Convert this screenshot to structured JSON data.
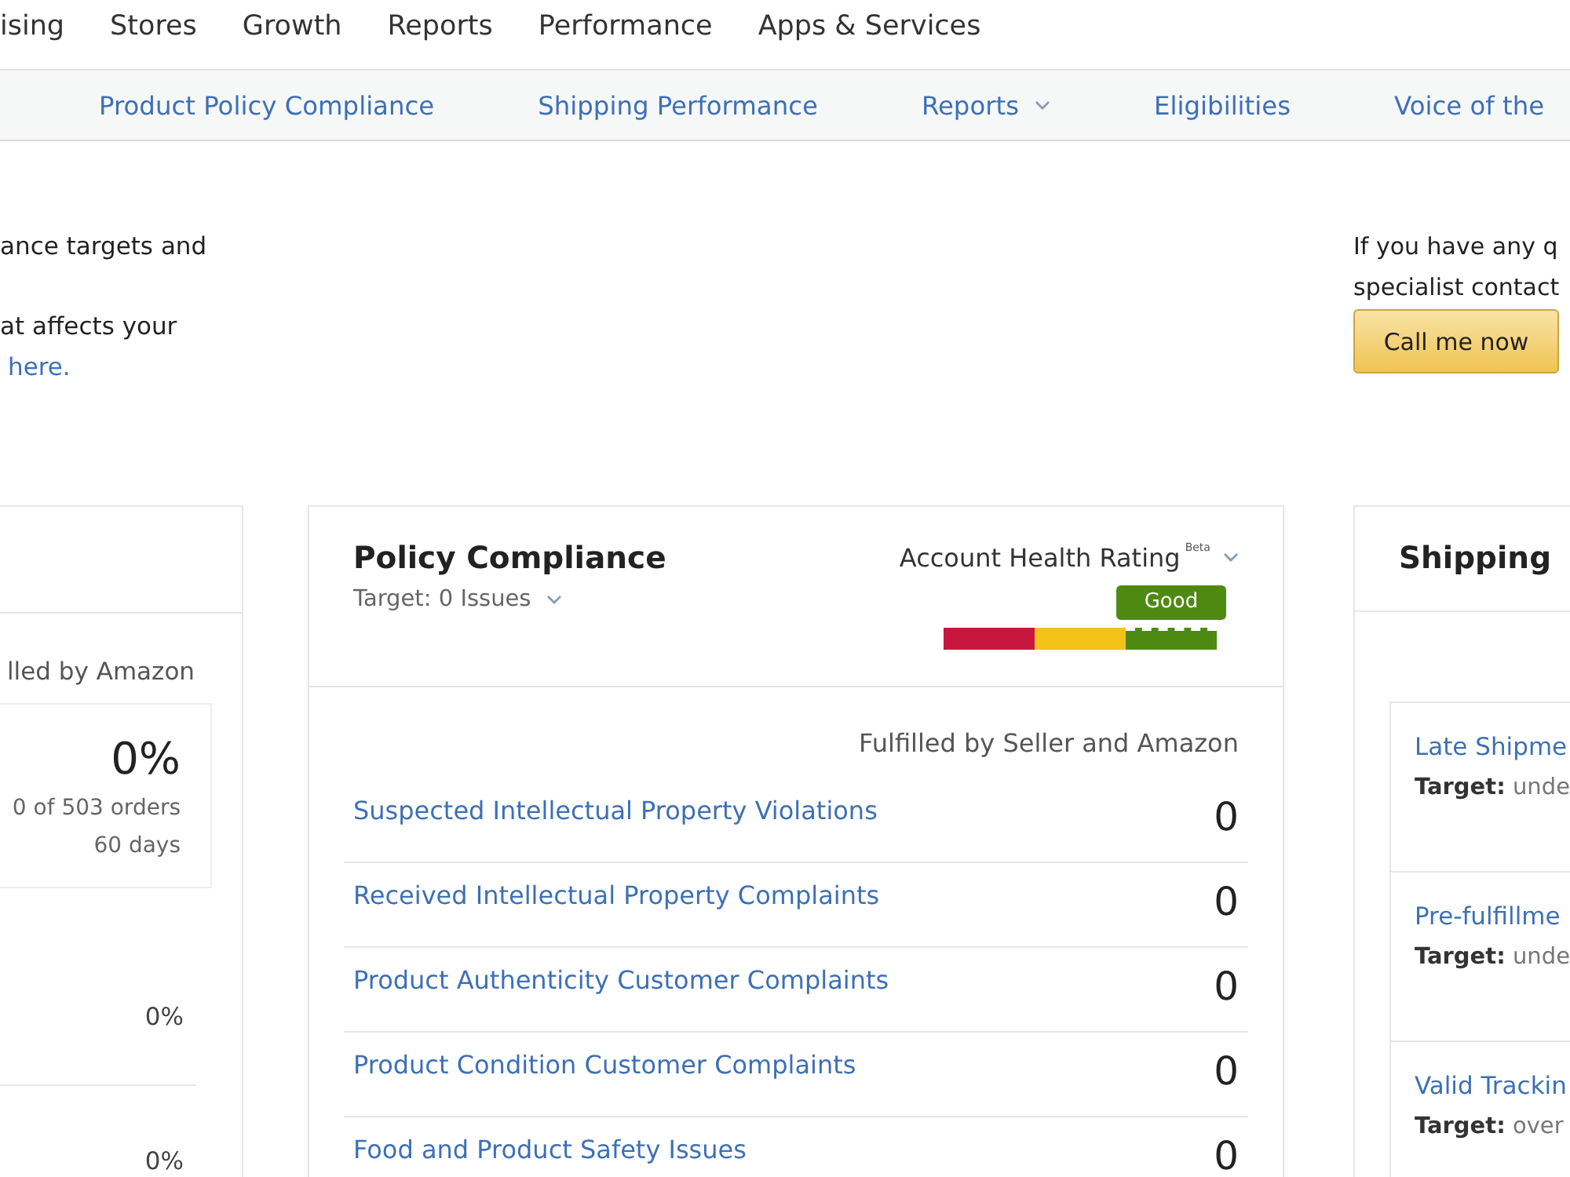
{
  "top_nav": {
    "items": [
      "ising",
      "Stores",
      "Growth",
      "Reports",
      "Performance",
      "Apps & Services"
    ]
  },
  "sub_nav": {
    "items": [
      {
        "label": "Product Policy Compliance",
        "dropdown": false
      },
      {
        "label": "Shipping Performance",
        "dropdown": false
      },
      {
        "label": "Reports",
        "dropdown": true
      },
      {
        "label": "Eligibilities",
        "dropdown": false
      },
      {
        "label": "Voice of the",
        "dropdown": false
      }
    ]
  },
  "intro": {
    "lines": [
      "ance targets and",
      "at affects your"
    ],
    "link": "here."
  },
  "contact": {
    "lines": [
      "If you have any q",
      "specialist contact"
    ],
    "button": "Call me now"
  },
  "left_card": {
    "subtitle": "lled by Amazon",
    "summary": {
      "value": "0%",
      "detail": "0 of 503 orders",
      "period": "60 days"
    },
    "rows": [
      {
        "value": "0%"
      },
      {
        "value": "0%"
      }
    ]
  },
  "policy_card": {
    "title": "Policy Compliance",
    "target": "Target: 0 Issues",
    "rating": {
      "label": "Account Health Rating",
      "tag": "Beta",
      "status": "Good",
      "segments": [
        {
          "color": "#c8173f",
          "selected": false
        },
        {
          "color": "#f2c21b",
          "selected": false
        },
        {
          "color": "#4e8a12",
          "selected": true
        }
      ]
    },
    "column_heading": "Fulfilled by Seller and Amazon",
    "rows": [
      {
        "label": "Suspected Intellectual Property Violations",
        "value": "0"
      },
      {
        "label": "Received Intellectual Property Complaints",
        "value": "0"
      },
      {
        "label": "Product Authenticity Customer Complaints",
        "value": "0"
      },
      {
        "label": "Product Condition Customer Complaints",
        "value": "0"
      },
      {
        "label": "Food and Product Safety Issues",
        "value": "0"
      }
    ]
  },
  "shipping_card": {
    "title": "Shipping",
    "items": [
      {
        "label": "Late Shipme",
        "target": "**Target:** unde"
      },
      {
        "label": "Pre-fulfillme",
        "target": "**Target:** unde"
      },
      {
        "label": "Valid Trackin",
        "target": "**Target:** over"
      }
    ]
  }
}
